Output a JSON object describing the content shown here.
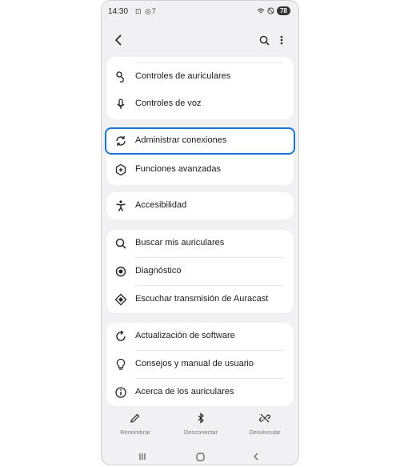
{
  "status": {
    "time": "14:30",
    "icons_left": "⊡ ◎7",
    "battery": "78"
  },
  "header": {
    "back_icon": "back-arrow-icon",
    "search_icon": "search-icon",
    "more_icon": "more-vert-icon"
  },
  "group1": [
    {
      "label": "Controles de auriculares",
      "icon": "earbud-touch-icon"
    },
    {
      "label": "Controles de voz",
      "icon": "microphone-icon"
    }
  ],
  "group2": [
    {
      "label": "Administrar conexiones",
      "icon": "sync-icon"
    },
    {
      "label": "Funciones avanzadas",
      "icon": "gear-plus-icon"
    }
  ],
  "group3": [
    {
      "label": "Accesibilidad",
      "icon": "accessibility-icon"
    }
  ],
  "group4": [
    {
      "label": "Buscar mis auriculares",
      "icon": "search-icon"
    },
    {
      "label": "Diagnóstico",
      "icon": "diagnostic-icon"
    },
    {
      "label": "Escuchar transmisión de Auracast",
      "icon": "auracast-icon"
    }
  ],
  "group5": [
    {
      "label": "Actualización de software",
      "icon": "refresh-icon"
    },
    {
      "label": "Consejos y manual de usuario",
      "icon": "bulb-icon"
    },
    {
      "label": "Acerca de los auriculares",
      "icon": "info-icon"
    }
  ],
  "bottom": [
    {
      "label": "Renombrar",
      "icon": "pencil-icon"
    },
    {
      "label": "Desconectar",
      "icon": "bluetooth-icon"
    },
    {
      "label": "Desvincular",
      "icon": "unlink-icon"
    }
  ]
}
